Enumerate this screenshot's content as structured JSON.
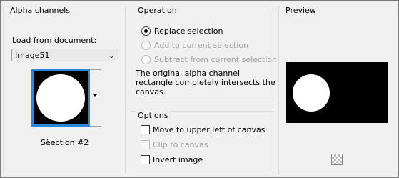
{
  "alpha": {
    "title": "Alpha channels",
    "load_label": "Load from document:",
    "document": "Image51",
    "selection_name": "Sëection #2"
  },
  "operation": {
    "title": "Operation",
    "options": [
      {
        "label": "Replace selection",
        "checked": true,
        "enabled": true
      },
      {
        "label": "Add to current selection",
        "checked": false,
        "enabled": false
      },
      {
        "label": "Subtract from current selection",
        "checked": false,
        "enabled": false
      }
    ],
    "description": [
      "The original alpha channel",
      "rectangle completely intersects the",
      "canvas."
    ]
  },
  "options": {
    "title": "Options",
    "items": [
      {
        "label": "Move to upper left of canvas",
        "checked": false,
        "enabled": true
      },
      {
        "label": "Clip to canvas",
        "checked": false,
        "enabled": false
      },
      {
        "label": "Invert image",
        "checked": false,
        "enabled": true
      }
    ]
  },
  "preview": {
    "title": "Preview"
  },
  "icons": {
    "dropdown": "chevron-down-icon",
    "checker": "transparency-checker-icon"
  }
}
